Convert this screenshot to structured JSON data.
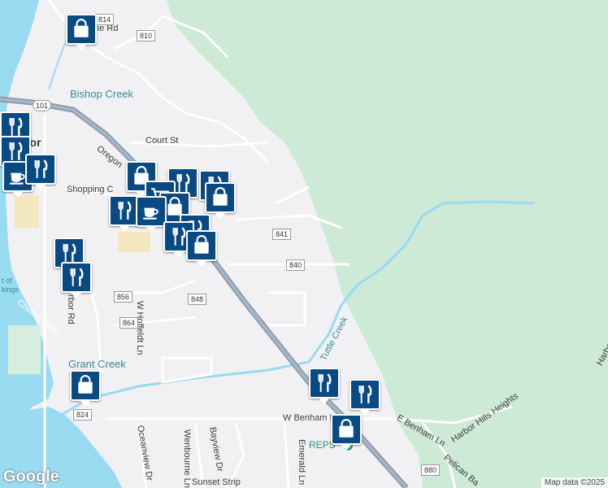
{
  "labels": {
    "bishop_creek": "Bishop Creek",
    "court_st": "Court St",
    "oregon": "Oregon",
    "shopping": "Shopping C",
    "hoffeldt": "W Hoffeldt Ln",
    "tuttle_creek": "Tuttle Creek",
    "grant_creek": "Grant Creek",
    "chetco_river": "Chetco River",
    "w_benham": "W Benham L",
    "e_benham": "E Benham Ln",
    "harbor_hills": "Harbor Hills Heights",
    "pelican": "Pelican Ba",
    "oceanview": "Oceanview Dr",
    "wenbourne": "Wenbourne Ln",
    "bayview": "Bayview Dr",
    "emerald": "Emerald Ln",
    "sunset": "Sunset Strip",
    "harbor_rd": "rbor Rd",
    "harbor_edge": "Harbo",
    "bor_fragment": "bor",
    "ne_rd": "ne Rd",
    "port_of": "t of",
    "kings": "kings",
    "reps": "REPS"
  },
  "shields": {
    "s814": "814",
    "s810": "810",
    "s101": "101",
    "s841": "841",
    "s840": "840",
    "s856": "856",
    "s848": "848",
    "s864": "864",
    "s824": "824",
    "s880": "880"
  },
  "markers": [
    {
      "id": "shopping-1",
      "icon": "shopping-bag-icon"
    },
    {
      "id": "restaurant-1",
      "icon": "restaurant-icon"
    },
    {
      "id": "restaurant-2",
      "icon": "restaurant-icon"
    },
    {
      "id": "cafe-1",
      "icon": "coffee-icon"
    },
    {
      "id": "restaurant-3",
      "icon": "restaurant-icon"
    },
    {
      "id": "shopping-2",
      "icon": "shopping-bag-icon"
    },
    {
      "id": "restaurant-4",
      "icon": "restaurant-icon"
    },
    {
      "id": "restaurant-5",
      "icon": "restaurant-icon"
    },
    {
      "id": "shopping-3",
      "icon": "shopping-bag-icon"
    },
    {
      "id": "grocery-1",
      "icon": "shopping-cart-icon"
    },
    {
      "id": "shopping-4",
      "icon": "shopping-bag-icon"
    },
    {
      "id": "restaurant-6",
      "icon": "restaurant-icon"
    },
    {
      "id": "cafe-2",
      "icon": "coffee-icon"
    },
    {
      "id": "restaurant-7",
      "icon": "restaurant-icon"
    },
    {
      "id": "restaurant-8",
      "icon": "restaurant-icon"
    },
    {
      "id": "shopping-5",
      "icon": "shopping-bag-icon"
    },
    {
      "id": "restaurant-9",
      "icon": "restaurant-icon"
    },
    {
      "id": "restaurant-10",
      "icon": "restaurant-icon"
    },
    {
      "id": "shopping-6",
      "icon": "shopping-bag-icon"
    },
    {
      "id": "restaurant-11",
      "icon": "restaurant-icon"
    },
    {
      "id": "restaurant-12",
      "icon": "restaurant-icon"
    },
    {
      "id": "shopping-7",
      "icon": "shopping-bag-icon"
    }
  ],
  "branding": {
    "google": "Google",
    "attribution": "Map data ©2025"
  },
  "colors": {
    "marker": "#0a4a82",
    "water": "#99dbf1",
    "forest": "#cdead6",
    "highway": "#8c9eae"
  }
}
